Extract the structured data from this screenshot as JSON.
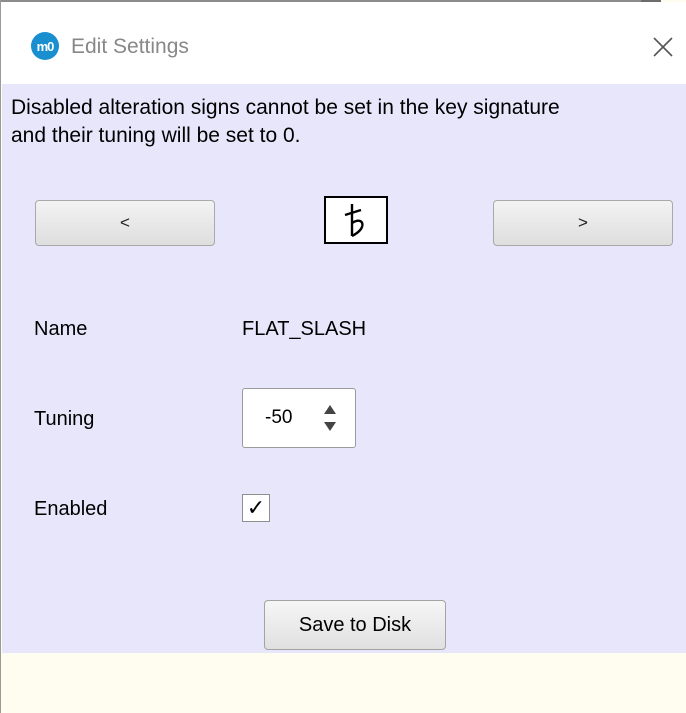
{
  "window": {
    "title": "Edit Settings",
    "app_icon_text": "m0",
    "close_icon": "close-icon"
  },
  "info": {
    "line1": "Disabled alteration signs cannot be set in the key signature",
    "line2": "and their tuning will be set to 0."
  },
  "navigation": {
    "prev_label": "<",
    "next_label": ">",
    "symbol_icon": "flat-slash-icon"
  },
  "fields": {
    "name_label": "Name",
    "name_value": "FLAT_SLASH",
    "tuning_label": "Tuning",
    "tuning_value": "-50",
    "enabled_label": "Enabled",
    "enabled_checked": true,
    "enabled_mark": "✓"
  },
  "actions": {
    "save_label": "Save to Disk"
  },
  "colors": {
    "content_bg": "#e8e6fb",
    "footer_bg": "#fffdf0",
    "app_icon": "#1a8fd0"
  }
}
